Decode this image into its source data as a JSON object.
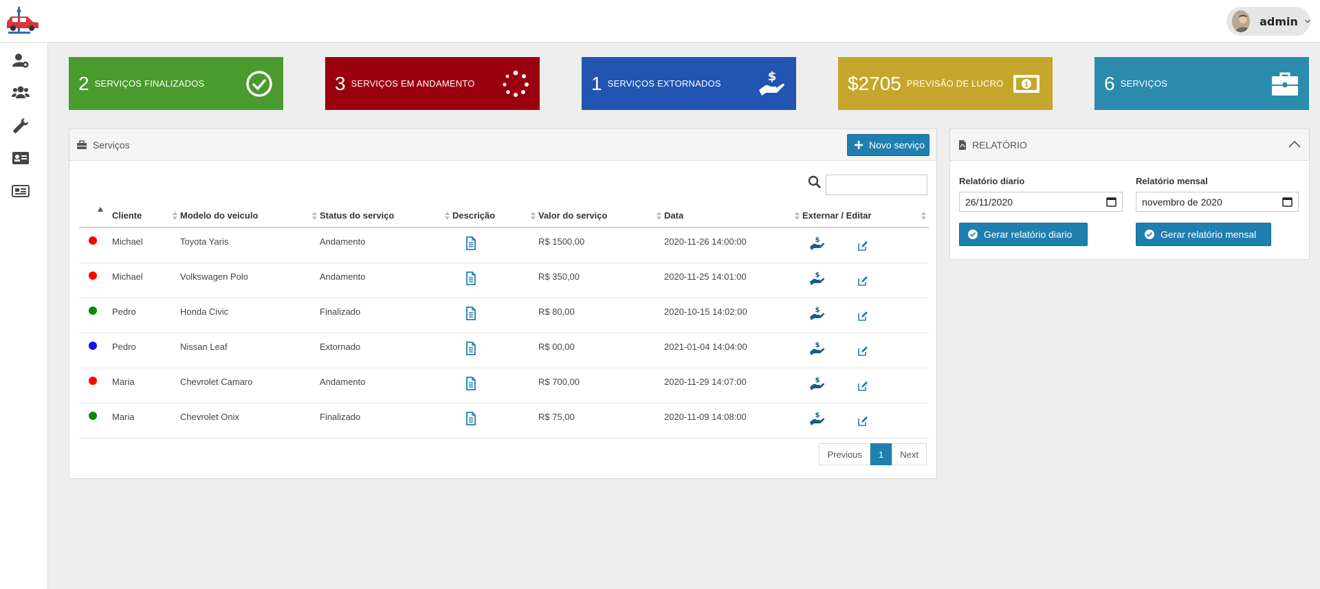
{
  "header": {
    "user_name": "admin"
  },
  "stats": [
    {
      "number": "2",
      "label": "Serviços finalizados",
      "color": "#4a9a2e",
      "icon": "check-circle-icon"
    },
    {
      "number": "3",
      "label": "Serviços em andamento",
      "color": "#9b000e",
      "icon": "spinner-icon"
    },
    {
      "number": "1",
      "label": "Serviços extornados",
      "color": "#2254b2",
      "icon": "hand-dollar-icon"
    },
    {
      "number": "$2705",
      "label": "Previsão de lucro",
      "color": "#c6a62a",
      "icon": "money-bill-icon"
    },
    {
      "number": "6",
      "label": "Serviços",
      "color": "#2a8bad",
      "icon": "briefcase-icon"
    }
  ],
  "services_panel": {
    "title": "Serviços",
    "new_button": "Novo serviço",
    "search_value": "",
    "columns": [
      "Cliente",
      "Modelo do veiculo",
      "Status do serviço",
      "Descrição",
      "Valor do serviço",
      "Data",
      "Externar / Editar"
    ],
    "rows": [
      {
        "status_color": "#ff0000",
        "cliente": "Michael",
        "modelo": "Toyota Yaris",
        "status": "Andamento",
        "valor": "R$ 1500,00",
        "data": "2020-11-26 14:00:00"
      },
      {
        "status_color": "#ff0000",
        "cliente": "Michael",
        "modelo": "Volkswagen Polo",
        "status": "Andamento",
        "valor": "R$ 350,00",
        "data": "2020-11-25 14:01:00"
      },
      {
        "status_color": "#0a8a0a",
        "cliente": "Pedro",
        "modelo": "Honda Civic",
        "status": "Finalizado",
        "valor": "R$ 80,00",
        "data": "2020-10-15 14:02:00"
      },
      {
        "status_color": "#1010ee",
        "cliente": "Pedro",
        "modelo": "Nissan Leaf",
        "status": "Extornado",
        "valor": "R$ 00,00",
        "data": "2021-01-04 14:04:00"
      },
      {
        "status_color": "#ff0000",
        "cliente": "Maria",
        "modelo": "Chevrolet Camaro",
        "status": "Andamento",
        "valor": "R$ 700,00",
        "data": "2020-11-29 14:07:00"
      },
      {
        "status_color": "#0a8a0a",
        "cliente": "Maria",
        "modelo": "Chevrolet Onix",
        "status": "Finalizado",
        "valor": "R$ 75,00",
        "data": "2020-11-09 14:08:00"
      }
    ],
    "pagination": {
      "previous": "Previous",
      "current": "1",
      "next": "Next"
    }
  },
  "report_panel": {
    "title": "RELATÓRIO",
    "daily_label": "Relatório diario",
    "daily_value": "26/11/2020",
    "monthly_label": "Relatório mensal",
    "monthly_value": "novembro de 2020",
    "daily_button": "Gerar relatório diario",
    "monthly_button": "Gerar relatório mensal"
  }
}
